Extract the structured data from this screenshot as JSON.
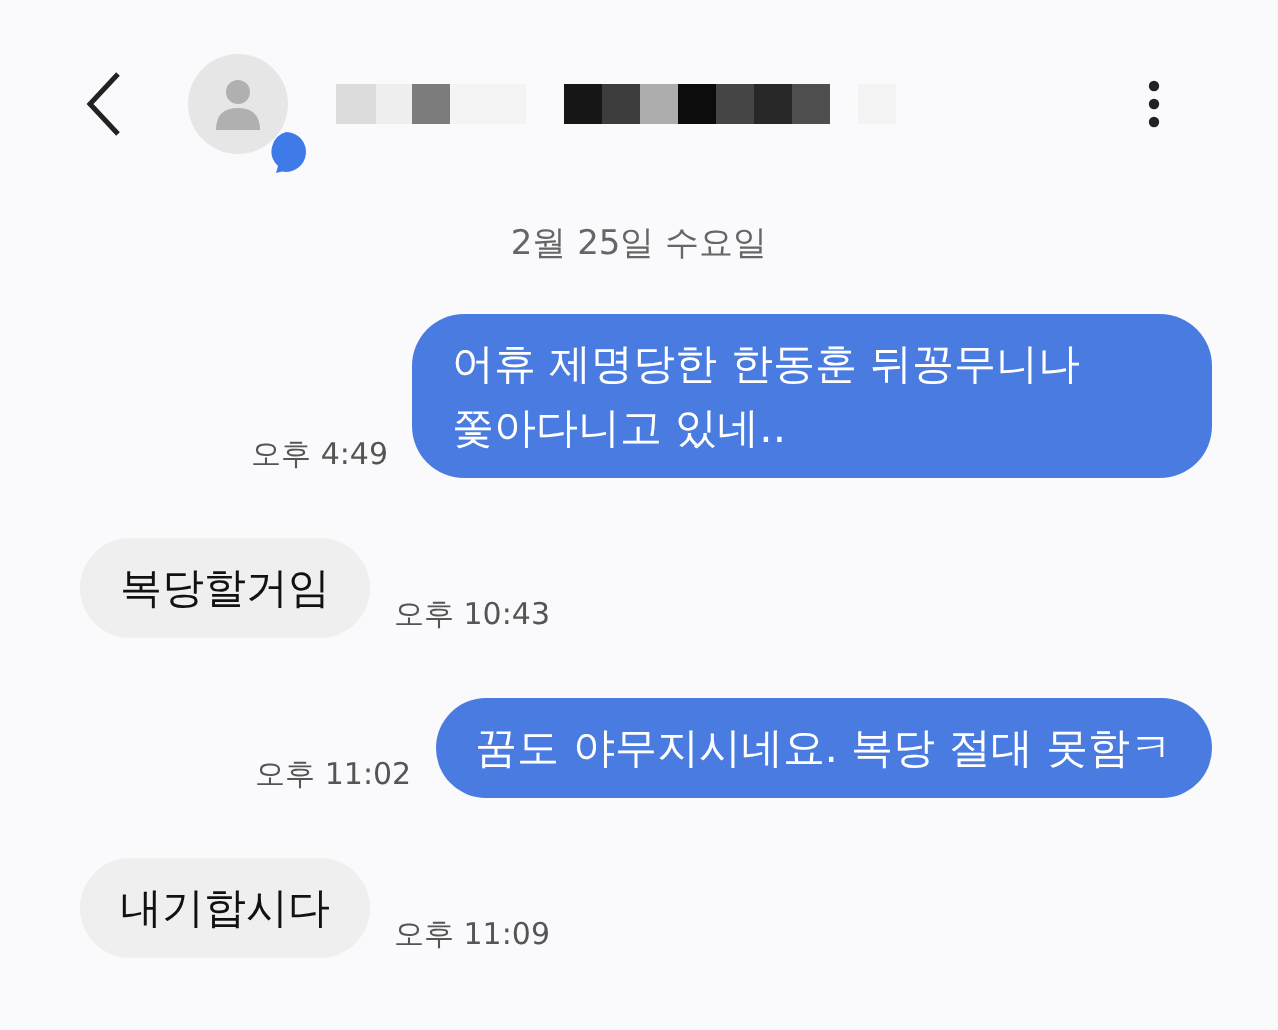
{
  "header": {
    "has_unread_badge": true
  },
  "date_divider": "2월 25일 수요일",
  "messages": [
    {
      "kind": "sent",
      "text": "어휴 제명당한 한동훈 뒤꽁무니나 쫓아다니고 있네..",
      "time": "오후 4:49"
    },
    {
      "kind": "received",
      "text": "복당할거임",
      "time": "오후 10:43"
    },
    {
      "kind": "sent",
      "text": "꿈도 야무지시네요. 복당 절대 못함ㅋ",
      "time": "오후 11:02"
    },
    {
      "kind": "received",
      "text": "내기합시다",
      "time": "오후 11:09"
    }
  ]
}
